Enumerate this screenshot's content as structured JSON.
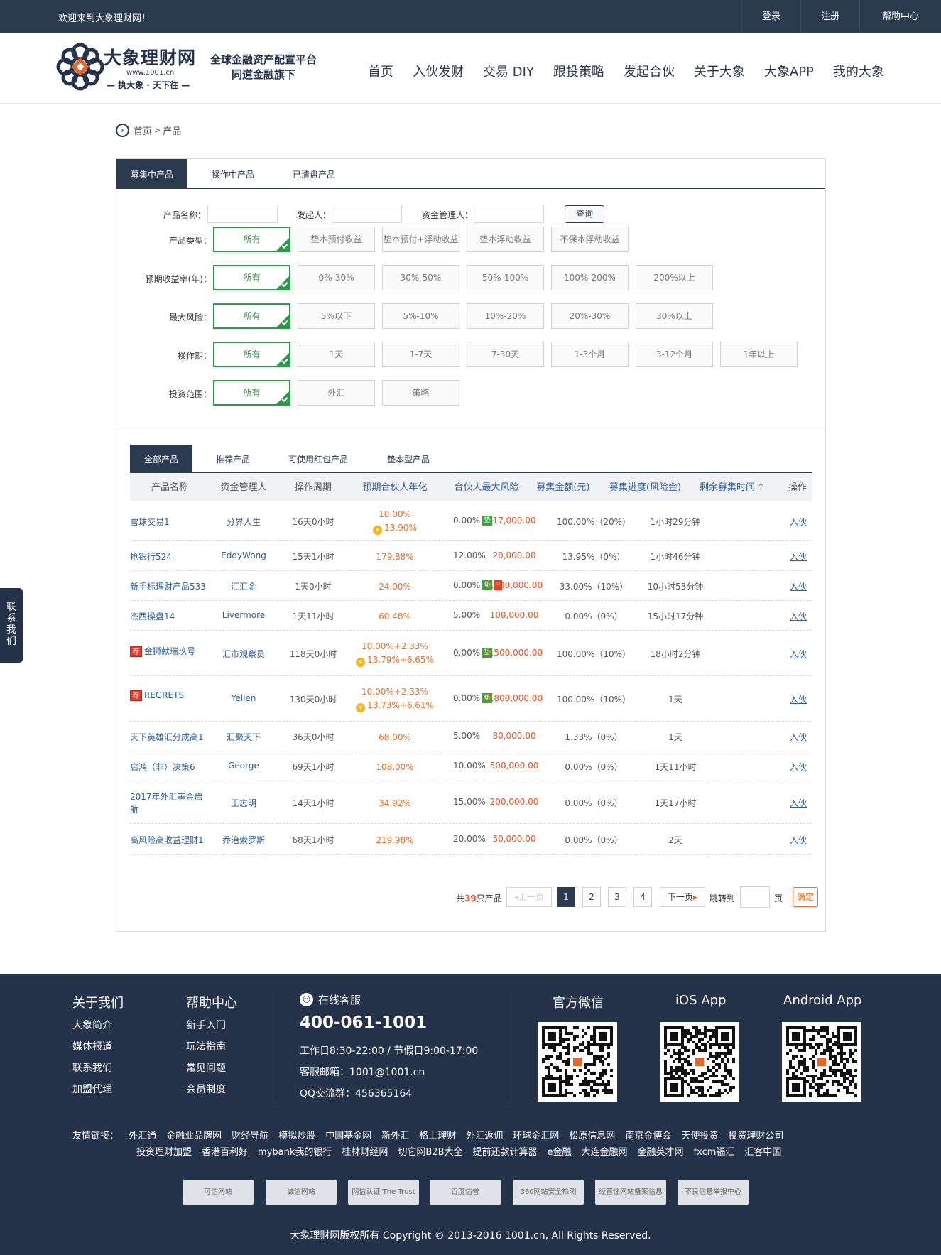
{
  "topbar": {
    "welcome": "欢迎来到大象理财网！",
    "links": [
      "登录",
      "注册",
      "帮助中心"
    ]
  },
  "logo": {
    "name": "大象理财网",
    "url": "www.1001.cn",
    "motto": "— 执大象 · 天下往 —"
  },
  "slogan": {
    "line1": "全球金融资产配置平台",
    "line2": "同道金融旗下"
  },
  "nav": [
    "首页",
    "入伙发财",
    "交易 DIY",
    "跟投策略",
    "发起合伙",
    "关于大象",
    "大象APP",
    "我的大象"
  ],
  "breadcrumb": {
    "home": "首页",
    "sep": ">",
    "current": "产品"
  },
  "tabs1": [
    "募集中产品",
    "操作中产品",
    "已清盘产品"
  ],
  "search": {
    "name_label": "产品名称：",
    "initiator_label": "发起人：",
    "manager_label": "资金管理人：",
    "button": "查询"
  },
  "filters": [
    {
      "label": "产品类型：",
      "options": [
        "所有",
        "垫本预付收益",
        "垫本预付+浮动收益",
        "垫本浮动收益",
        "不保本浮动收益"
      ]
    },
    {
      "label": "预期收益率(年)：",
      "options": [
        "所有",
        "0%-30%",
        "30%-50%",
        "50%-100%",
        "100%-200%",
        "200%以上"
      ]
    },
    {
      "label": "最大风险：",
      "options": [
        "所有",
        "5%以下",
        "5%-10%",
        "10%-20%",
        "20%-30%",
        "30%以上"
      ]
    },
    {
      "label": "操作期：",
      "options": [
        "所有",
        "1天",
        "1-7天",
        "7-30天",
        "1-3个月",
        "3-12个月",
        "1年以上"
      ]
    },
    {
      "label": "投资范围：",
      "options": [
        "所有",
        "外汇",
        "策略"
      ]
    }
  ],
  "tabs2": [
    "全部产品",
    "推荐产品",
    "可使用红包产品",
    "垫本型产品"
  ],
  "columns": [
    "产品名称",
    "资金管理人",
    "操作周期",
    "预期合伙人年化",
    "合伙人最大风险",
    "募集金额(元)",
    "募集进度(风险金)",
    "剩余募集时间",
    "操作"
  ],
  "sort_arrow": "↑",
  "rows": [
    {
      "name": "雪球交易1",
      "mgr": "分界人生",
      "period": "16天0小时",
      "rate1": "10.00%",
      "rate2": "13.90%",
      "coin": "¥",
      "risk": "0.00%",
      "dian": "垫",
      "yen": "",
      "jian": "",
      "amount": "17,000.00",
      "progress": "100.00%（20%）",
      "remain": "1小时29分钟",
      "op": "入伙"
    },
    {
      "name": "抢银行524",
      "mgr": "EddyWong",
      "period": "15天1小时",
      "rate1": "179.88%",
      "rate2": "",
      "coin": "",
      "risk": "12.00%",
      "dian": "",
      "yen": "",
      "jian": "",
      "amount": "20,000.00",
      "progress": "13.95%（0%）",
      "remain": "1小时46分钟",
      "op": "入伙"
    },
    {
      "name": "新手标理财产品533",
      "mgr": "汇汇金",
      "period": "1天0小时",
      "rate1": "24.00%",
      "rate2": "",
      "coin": "",
      "risk": "0.00%",
      "dian": "垫",
      "yen": "¥",
      "jian": "",
      "amount": "1,000,000.00",
      "progress": "33.00%（10%）",
      "remain": "10小时53分钟",
      "op": "入伙"
    },
    {
      "name": "杰西操盘14",
      "mgr": "Livermore",
      "period": "1天11小时",
      "rate1": "60.48%",
      "rate2": "",
      "coin": "",
      "risk": "5.00%",
      "dian": "",
      "yen": "",
      "jian": "",
      "amount": "100,000.00",
      "progress": "0.00%（0%）",
      "remain": "15小时17分钟",
      "op": "入伙"
    },
    {
      "name": "金狮献瑞玖号",
      "mgr": "汇市观察员",
      "period": "118天0小时",
      "rate1": "10.00%+2.33%",
      "rate2": "13.79%+6.65%",
      "coin": "¥",
      "risk": "0.00%",
      "dian": "垫",
      "yen": "",
      "jian": "荐",
      "amount": "5,500,000.00",
      "progress": "100.00%（10%）",
      "remain": "18小时2分钟",
      "op": "入伙"
    },
    {
      "name": "REGRETS",
      "mgr": "Yellen",
      "period": "130天0小时",
      "rate1": "10.00%+2.33%",
      "rate2": "13.73%+6.61%",
      "coin": "¥",
      "risk": "0.00%",
      "dian": "垫",
      "yen": "",
      "jian": "荐",
      "amount": "7,800,000.00",
      "progress": "100.00%（10%）",
      "remain": "1天",
      "op": "入伙"
    },
    {
      "name": "天下英雄汇分成高1",
      "mgr": "汇聚天下",
      "period": "36天0小时",
      "rate1": "68.00%",
      "rate2": "",
      "coin": "",
      "risk": "5.00%",
      "dian": "",
      "yen": "",
      "jian": "",
      "amount": "80,000.00",
      "progress": "1.33%（0%）",
      "remain": "1天",
      "op": "入伙"
    },
    {
      "name": "启鸿（非）决策6",
      "mgr": "George",
      "period": "69天1小时",
      "rate1": "108.00%",
      "rate2": "",
      "coin": "",
      "risk": "10.00%",
      "dian": "",
      "yen": "",
      "jian": "",
      "amount": "500,000.00",
      "progress": "0.00%（0%）",
      "remain": "1天11小时",
      "op": "入伙"
    },
    {
      "name": "2017年外汇黄金启",
      "name2": "航",
      "mgr": "王志明",
      "period": "14天1小时",
      "rate1": "34.92%",
      "rate2": "",
      "coin": "",
      "risk": "15.00%",
      "dian": "",
      "yen": "",
      "jian": "",
      "amount": "200,000.00",
      "progress": "0.00%（0%）",
      "remain": "1天17小时",
      "op": "入伙"
    },
    {
      "name": "高风险高收益理财1",
      "mgr": "乔治索罗斯",
      "period": "68天1小时",
      "rate1": "219.98%",
      "rate2": "",
      "coin": "",
      "risk": "20.00%",
      "dian": "",
      "yen": "",
      "jian": "",
      "amount": "50,000.00",
      "progress": "0.00%（0%）",
      "remain": "2天",
      "op": "入伙"
    }
  ],
  "pager": {
    "total_prefix": "共",
    "total": "39",
    "total_suffix": "只产品",
    "prev": "上一页",
    "pages": [
      "1",
      "2",
      "3",
      "4"
    ],
    "next": "下一页",
    "jump": "跳转到",
    "page_unit": "页",
    "confirm": "确定"
  },
  "sidetab": "联系我们",
  "footer": {
    "about": {
      "title": "关于我们",
      "links": [
        "大象简介",
        "媒体报道",
        "联系我们",
        "加盟代理"
      ]
    },
    "help": {
      "title": "帮助中心",
      "links": [
        "新手入门",
        "玩法指南",
        "常见问题",
        "会员制度"
      ]
    },
    "service": {
      "title": "在线客服",
      "phone": "400-061-1001",
      "hours": "工作日8:30-22:00 / 节假日9:00-17:00",
      "email": "客服邮箱：1001@1001.cn",
      "qq": "QQ交流群：456365164"
    },
    "qrs": [
      "官方微信",
      "iOS App",
      "Android App"
    ],
    "friend_label": "友情链接：",
    "friend_row1": [
      "外汇通",
      "金融业品牌网",
      "财经导航",
      "模拟炒股",
      "中国基金网",
      "新外汇",
      "格上理财",
      "外汇返佣",
      "环球金汇网",
      "松原信息网",
      "南京金博会",
      "天使投资",
      "投资理财公司"
    ],
    "friend_row2": [
      "投资理财加盟",
      "香港百利好",
      "mybank我的银行",
      "桂林财经网",
      "切它网B2B大全",
      "提前还款计算器",
      "e金融",
      "大连金融网",
      "金融英才网",
      "fxcm福汇",
      "汇客中国"
    ],
    "badges": [
      "可信网站",
      "诚信网站",
      "网信认证 The Trust",
      "百度信誉",
      "360网站安全检测",
      "经营性网站备案信息",
      "不良信息举报中心"
    ],
    "copyright": "大象理财网版权所有 Copyright © 2013-2016 1001.cn, All Rights Reserved."
  },
  "colors": {
    "navy": "#2a3a4f",
    "green": "#2d9a48",
    "orange": "#ff6a1a",
    "blue": "#2a5c9e"
  }
}
